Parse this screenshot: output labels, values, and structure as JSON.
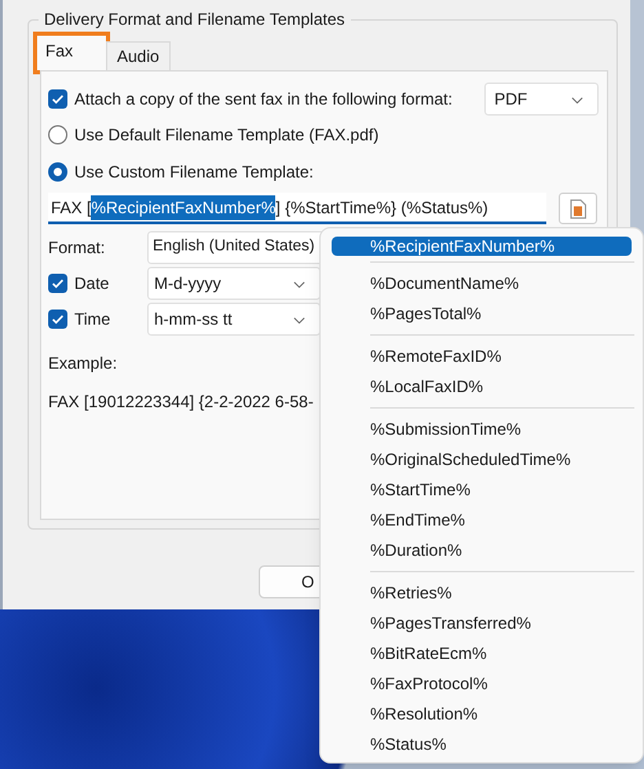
{
  "group_box": {
    "title": "Delivery Format and Filename Templates"
  },
  "tabs": [
    {
      "label": "Fax",
      "selected": true,
      "highlighted": true
    },
    {
      "label": "Audio",
      "selected": false,
      "highlighted": false
    }
  ],
  "attach": {
    "label": "Attach a copy of the sent fax in the following format:",
    "checked": true,
    "format": "PDF"
  },
  "filename_options": [
    {
      "label": "Use Default Filename Template (FAX.pdf)",
      "selected": false
    },
    {
      "label": "Use Custom Filename Template:",
      "selected": true
    }
  ],
  "template_field": {
    "parts": [
      {
        "text": "FAX [",
        "selected": false
      },
      {
        "text": "%RecipientFaxNumber%",
        "selected": true
      },
      {
        "text": "] {%StartTime%} (%Status%)",
        "selected": false
      }
    ]
  },
  "format": {
    "label": "Format:",
    "value": "English (United States)"
  },
  "timestamp_rows": [
    {
      "label": "Date",
      "checked": true,
      "value": "M-d-yyyy"
    },
    {
      "label": "Time",
      "checked": true,
      "value": "h-mm-ss tt"
    }
  ],
  "example": {
    "label": "Example:",
    "value": "FAX [19012223344] {2-2-2022 6-58-"
  },
  "buttons": [
    {
      "label": "O"
    }
  ],
  "menu": {
    "sections": [
      {
        "items": [
          {
            "label": "%RecipientFaxNumber%",
            "selected": true
          }
        ]
      },
      {
        "items": [
          {
            "label": "%DocumentName%",
            "selected": false
          },
          {
            "label": "%PagesTotal%",
            "selected": false
          }
        ]
      },
      {
        "items": [
          {
            "label": "%RemoteFaxID%",
            "selected": false
          },
          {
            "label": "%LocalFaxID%",
            "selected": false
          }
        ]
      },
      {
        "items": [
          {
            "label": "%SubmissionTime%",
            "selected": false
          },
          {
            "label": "%OriginalScheduledTime%",
            "selected": false
          },
          {
            "label": "%StartTime%",
            "selected": false
          },
          {
            "label": "%EndTime%",
            "selected": false
          },
          {
            "label": "%Duration%",
            "selected": false
          }
        ]
      },
      {
        "items": [
          {
            "label": "%Retries%",
            "selected": false
          },
          {
            "label": "%PagesTransferred%",
            "selected": false
          },
          {
            "label": "%BitRateEcm%",
            "selected": false
          },
          {
            "label": "%FaxProtocol%",
            "selected": false
          },
          {
            "label": "%Resolution%",
            "selected": false
          },
          {
            "label": "%Status%",
            "selected": false
          }
        ]
      }
    ]
  }
}
